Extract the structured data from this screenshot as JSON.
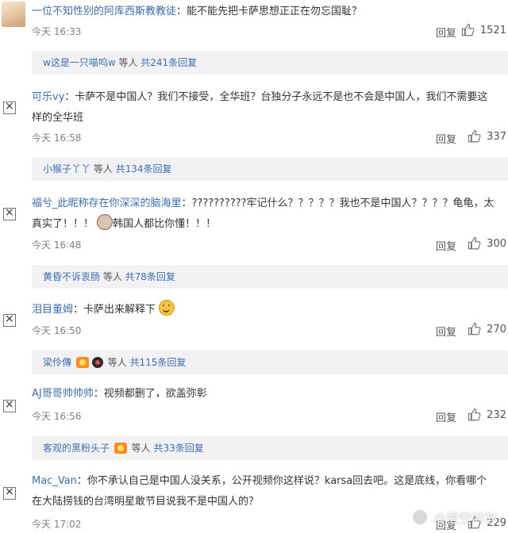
{
  "comments": [
    {
      "author": "一位不知性别的阿库西斯教教徒",
      "text": "：能不能先把卡萨思想正正在勿忘国耻？",
      "time": "今天 16:33",
      "reply_label": "回复",
      "likes": "1521",
      "sub": {
        "who": "w这是一只喵呜w",
        "suffix": " 等人 ",
        "count": "共241条回复"
      }
    },
    {
      "author": "可乐vy",
      "text": "：卡萨不是中国人？我们不接受，全华班？台独分子永远不是也不会是中国人，我们不需要这样的全华班",
      "time": "今天 16:58",
      "reply_label": "回复",
      "likes": "337",
      "sub": {
        "who": "小猴子丫丫",
        "suffix": " 等人 ",
        "count": "共134条回复"
      }
    },
    {
      "author": "福兮_此昵称存在你深深的脑海里",
      "text": "：??????????牢记什么？？？？？我也不是中国人？？？？龟龟，太真实了！！！",
      "text2": "韩国人都比你懂！！！",
      "time": "今天 16:48",
      "reply_label": "回复",
      "likes": "300",
      "sub": {
        "who": "黄昏不诉衷肠",
        "suffix": " 等人 ",
        "count": "共78条回复"
      }
    },
    {
      "author": "泪目董姆",
      "text": "：卡萨出来解释下",
      "time": "今天 16:50",
      "reply_label": "回复",
      "likes": "270",
      "sub": {
        "who": "梁伶傳",
        "suffix": " 等人 ",
        "count": "共115条回复"
      }
    },
    {
      "author": "AJ哥哥帅帅帅",
      "text": "：视频都删了，欲盖弥彰",
      "time": "今天 16:56",
      "reply_label": "回复",
      "likes": "232",
      "sub": {
        "who": "客观的黑粉头子",
        "suffix": " 等人 ",
        "count": "共33条回复"
      }
    },
    {
      "author": "Mac_Van",
      "text": "：你不承认自己是中国人没关系，公开视频你这样说？karsa回去吧。这是底线，你看哪个在大陆捞钱的台湾明星敢节目说我不是中国人的？",
      "time": "今天 17:02",
      "reply_label": "回复",
      "likes": "229"
    }
  ],
  "watermark": {
    "text": "@悟空问答"
  },
  "colors": {
    "link": "#3b6fb6",
    "subbox_bg": "#f2f2f5",
    "meta": "#808080"
  }
}
